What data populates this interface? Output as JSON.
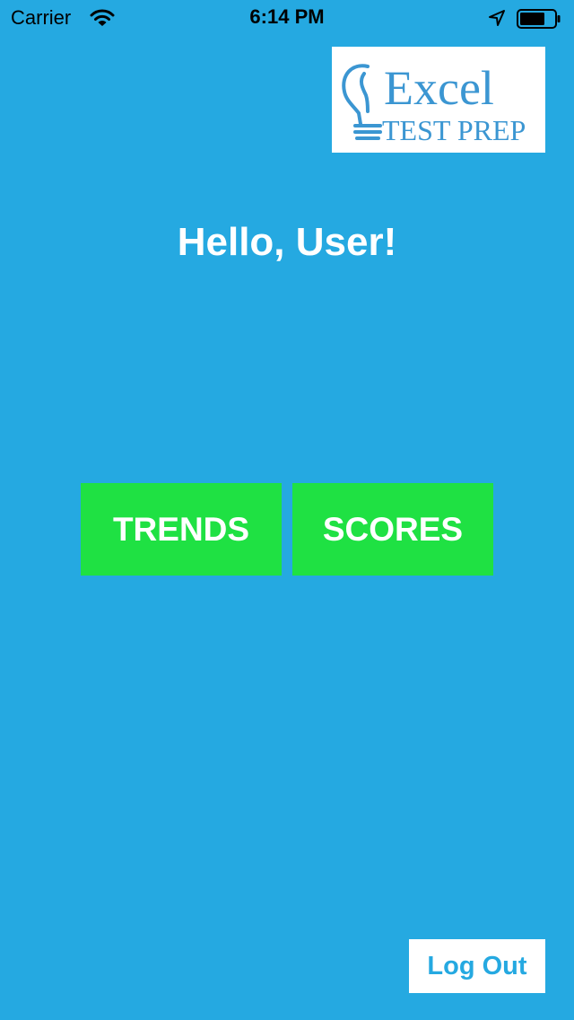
{
  "status_bar": {
    "carrier": "Carrier",
    "time": "6:14 PM",
    "icons": [
      "wifi-icon",
      "location-arrow-icon",
      "battery-icon"
    ]
  },
  "logo": {
    "line1": "Excel",
    "line2": "TEST PREP",
    "color": "#3b96d2"
  },
  "greeting": "Hello, User!",
  "actions": {
    "trends_label": "TRENDS",
    "scores_label": "SCORES"
  },
  "logout_label": "Log Out",
  "colors": {
    "background": "#25a9e1",
    "button": "#1fe143",
    "text": "#ffffff"
  }
}
